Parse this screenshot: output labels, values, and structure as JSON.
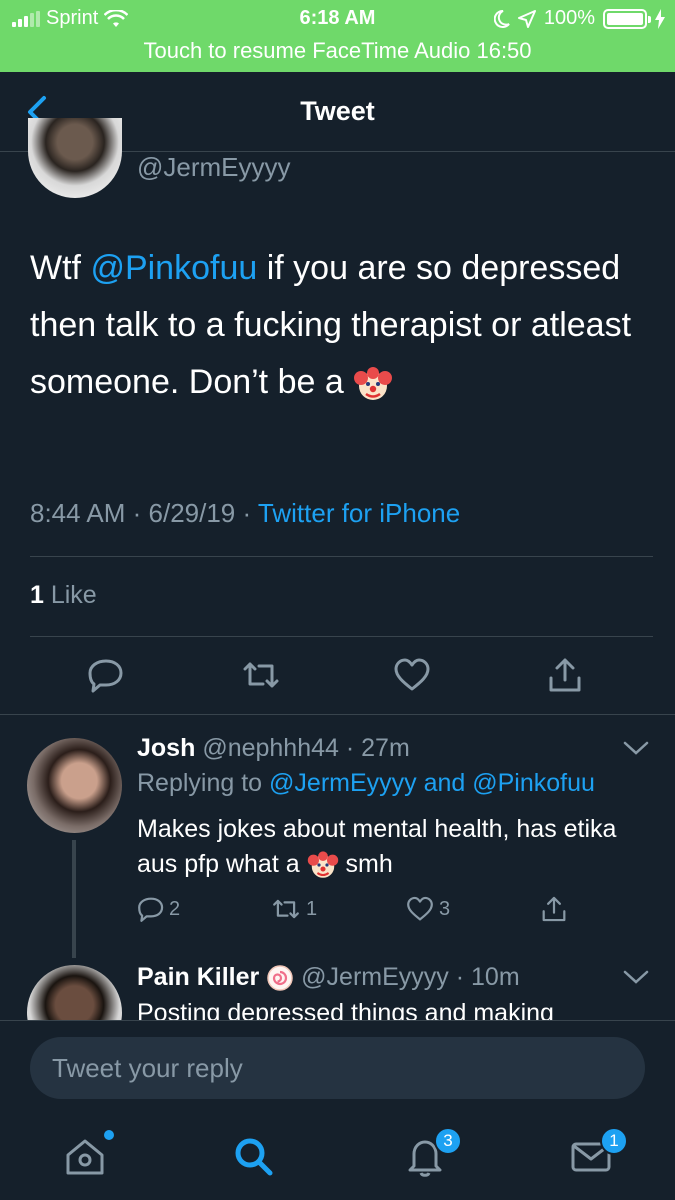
{
  "status_bar": {
    "carrier": "Sprint",
    "time": "6:18 AM",
    "battery": "100%",
    "battery_level": 1.0
  },
  "banner": {
    "text": "Touch to resume FaceTime Audio 16:50"
  },
  "nav": {
    "title": "Tweet"
  },
  "tweet": {
    "handle": "@JermEyyyy",
    "text_before": "Wtf ",
    "mention": "@Pinkofuu",
    "text_after": " if you are so depressed then talk to a fucking therapist or atleast someone. Don’t be a ",
    "time": "8:44 AM",
    "date": "6/29/19",
    "separator": " · ",
    "source": "Twitter for iPhone",
    "likes_count": "1",
    "likes_label": " Like"
  },
  "replies": [
    {
      "name": "Josh",
      "handle": "@nephhh44",
      "time": "· 27m",
      "replying_prefix": "Replying to ",
      "replying_users": "@JermEyyyy and @Pinkofuu",
      "text_before": "Makes jokes about mental health, has etika aus pfp what a ",
      "text_after": " smh",
      "reply_count": "2",
      "retweet_count": "1",
      "like_count": "3"
    },
    {
      "name": "Pain Killer",
      "handle": "@JermEyyyy",
      "time": "· 10m",
      "text": "Posting depressed things and making"
    }
  ],
  "composer": {
    "placeholder": "Tweet your reply"
  },
  "tabbar": {
    "notifications_badge": "3",
    "messages_badge": "1"
  },
  "colors": {
    "accent": "#1da1f2",
    "background": "#15202b",
    "banner": "#6fd96a",
    "muted": "#8899a6",
    "divider": "#38444d"
  }
}
